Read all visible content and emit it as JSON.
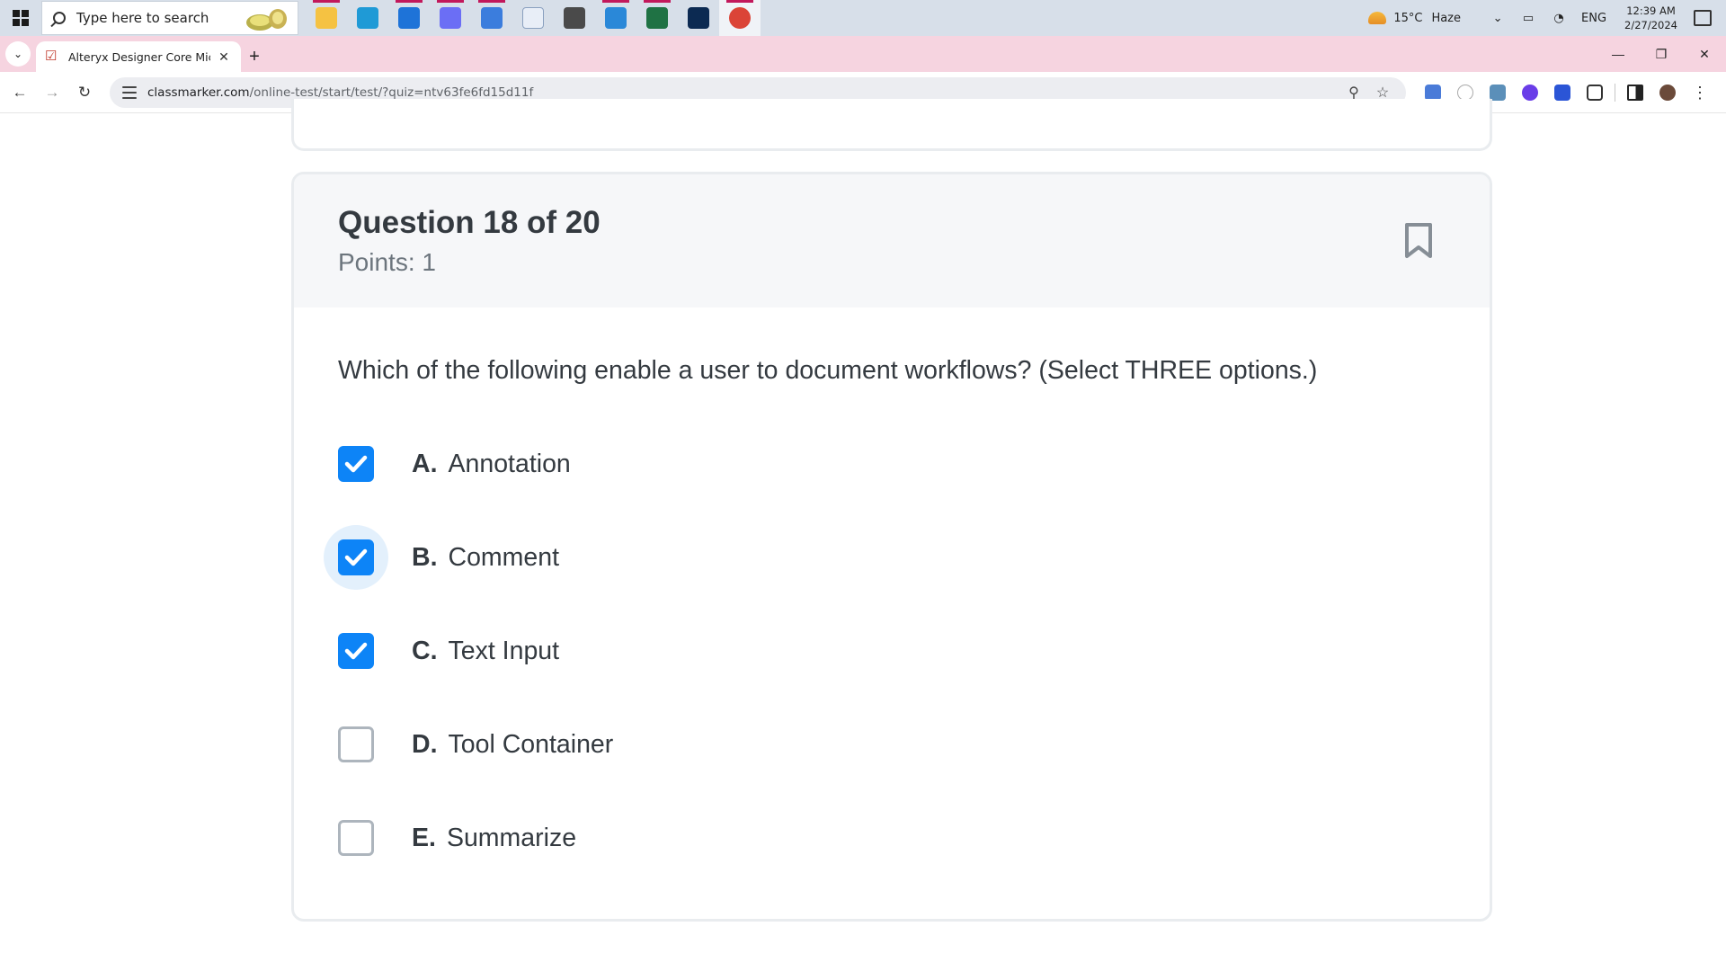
{
  "taskbar": {
    "search_placeholder": "Type here to search",
    "apps": [
      {
        "icon": "file-explorer-icon",
        "color": "#f5c242",
        "active": true
      },
      {
        "icon": "edge-icon",
        "color": "#1f9ad6",
        "active": false
      },
      {
        "icon": "mail-icon",
        "color": "#1e73d8",
        "active": true
      },
      {
        "icon": "copilot-icon",
        "color": "#6b6ef5",
        "active": true
      },
      {
        "icon": "azure-icon",
        "color": "#3b7ddd",
        "active": true
      },
      {
        "icon": "document-icon",
        "color": "#e8eef7",
        "active": false
      },
      {
        "icon": "settings-icon",
        "color": "#4a4a4a",
        "active": false
      },
      {
        "icon": "photos-icon",
        "color": "#2a88d8",
        "active": true
      },
      {
        "icon": "excel-icon",
        "color": "#1f7244",
        "active": true
      },
      {
        "icon": "powershell-icon",
        "color": "#0c2a52",
        "active": false
      },
      {
        "icon": "chrome-icon",
        "color": "#db4437",
        "active": true
      }
    ],
    "weather_temp": "15°C",
    "weather_desc": "Haze",
    "language": "ENG",
    "time": "12:39 AM",
    "date": "2/27/2024"
  },
  "browser": {
    "tab_title": "Alteryx Designer Core Micro-Cr",
    "url_host": "classmarker.com",
    "url_path": "/online-test/start/test/?quiz=ntv63fe6fd15d11f",
    "accent": "#f6d4e0"
  },
  "question": {
    "title": "Question 18 of 20",
    "points": "Points: 1",
    "text": "Which of the following enable a user to document workflows? (Select THREE options.)",
    "options": [
      {
        "letter": "A.",
        "label": "Annotation",
        "checked": true
      },
      {
        "letter": "B.",
        "label": "Comment",
        "checked": true
      },
      {
        "letter": "C.",
        "label": "Text Input",
        "checked": true
      },
      {
        "letter": "D.",
        "label": "Tool Container",
        "checked": false
      },
      {
        "letter": "E.",
        "label": "Summarize",
        "checked": false
      }
    ],
    "checkbox_color": "#0d84f7"
  }
}
